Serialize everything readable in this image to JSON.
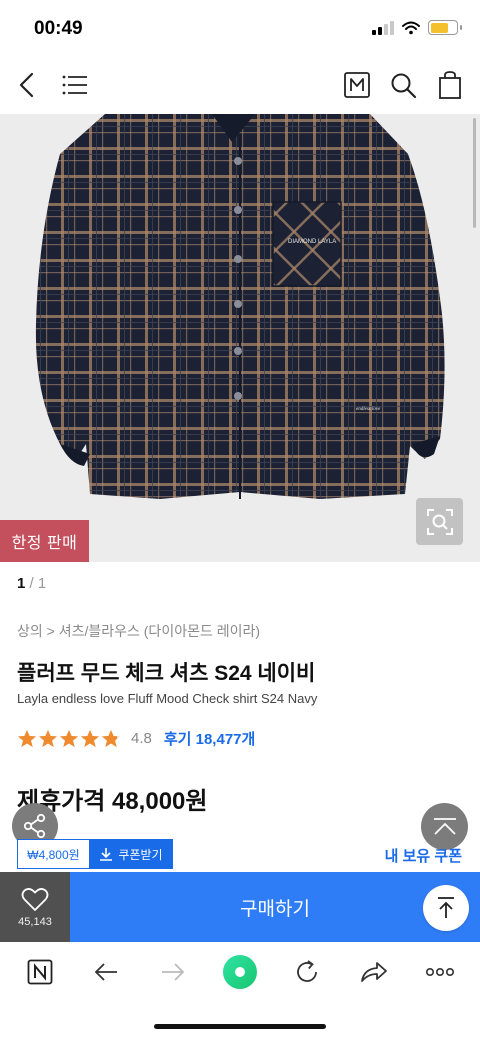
{
  "status": {
    "time": "00:49"
  },
  "hero": {
    "badge": "한정 판매",
    "pager_current": "1",
    "pager_total": " / 1"
  },
  "product": {
    "breadcrumb": "상의 > 셔츠/블라우스 (다이아몬드 레이라)",
    "title": "플러프 무드 체크 셔츠 S24 네이비",
    "subtitle": "Layla endless love Fluff Mood Check shirt S24 Navy",
    "rating": 4.8,
    "rating_text": "4.8",
    "reviews": "후기 18,477개",
    "price": "제휴가격 48,000원"
  },
  "coupon": {
    "amount": "₩4,800원",
    "get_label": "쿠폰받기",
    "my_coupon": "내 보유 쿠폰"
  },
  "action": {
    "like_count": "45,143",
    "buy_label": "구매하기"
  },
  "icons": {
    "back": "chevron-left-icon",
    "menu": "hamburger-icon",
    "brand": "m-box-icon",
    "search": "search-icon",
    "cart": "shopping-bag-icon",
    "zoom": "zoom-icon",
    "share": "share-icon",
    "top": "arrow-up-icon",
    "heart": "heart-icon",
    "browser_home": "n-logo-icon",
    "browser_back": "arrow-left-icon",
    "browser_forward": "arrow-right-icon",
    "browser_green": "green-dot-icon",
    "browser_refresh": "refresh-icon",
    "browser_share": "share-arrow-icon",
    "browser_more": "more-icon"
  },
  "colors": {
    "accent": "#2f7df6",
    "badge": "#c4505e",
    "star": "#f08a2e",
    "link": "#1a6be8",
    "like_bg": "#505050"
  }
}
